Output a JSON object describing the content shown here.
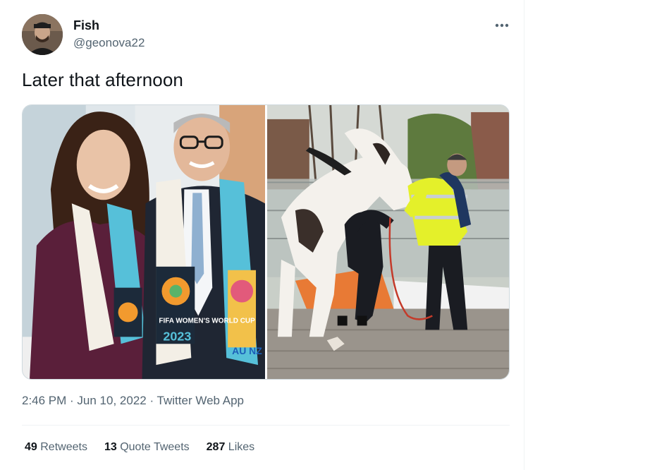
{
  "author": {
    "display_name": "Fish",
    "handle": "@geonova22"
  },
  "tweet": {
    "text": "Later that afternoon",
    "time": "2:46 PM",
    "date": "Jun 10, 2022",
    "source": "Twitter Web App",
    "separator": " · "
  },
  "stats": {
    "retweets": {
      "count": "49",
      "label": "Retweets"
    },
    "quote_tweets": {
      "count": "13",
      "label": "Quote Tweets"
    },
    "likes": {
      "count": "287",
      "label": "Likes"
    }
  },
  "media": {
    "left_photo": {
      "scarf_text_1": "FIFA WOMEN'S WORLD CUP",
      "scarf_year": "2023",
      "scarf_text_2": "AU NZ"
    },
    "right_photo": {}
  },
  "icons": {
    "more": "more-horizontal-icon"
  },
  "colors": {
    "text_primary": "#0f1419",
    "text_secondary": "#536471",
    "border": "#cfd9de",
    "police_hivis": "#e4f02a"
  }
}
